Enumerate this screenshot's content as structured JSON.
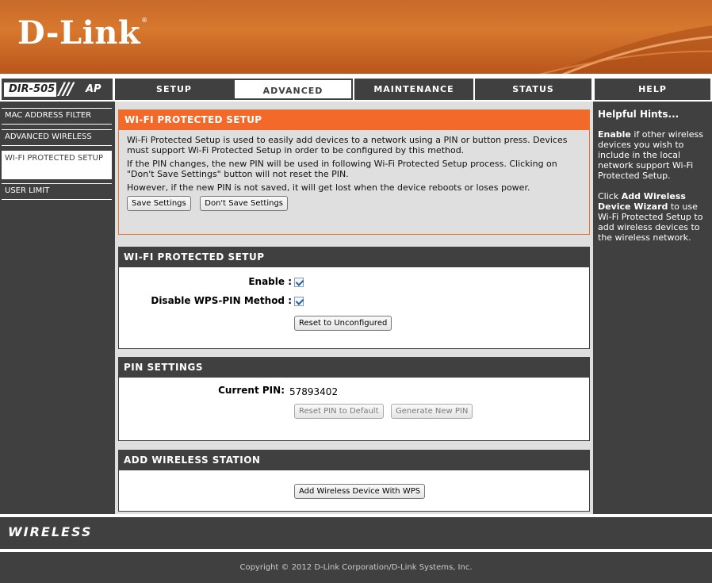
{
  "brand": {
    "logo": "D-Link",
    "registered": "®",
    "model": "DIR-505",
    "slash": "///",
    "mode": "AP"
  },
  "nav": {
    "tabs": [
      {
        "label": "SETUP",
        "active": false
      },
      {
        "label": "ADVANCED",
        "active": true
      },
      {
        "label": "MAINTENANCE",
        "active": false
      },
      {
        "label": "STATUS",
        "active": false
      },
      {
        "label": "HELP",
        "active": false
      }
    ]
  },
  "sidebar": {
    "items": [
      {
        "label": "MAC ADDRESS FILTER",
        "active": false
      },
      {
        "label": "ADVANCED WIRELESS",
        "active": false
      },
      {
        "label": "WI-FI PROTECTED SETUP",
        "active": true
      },
      {
        "label": "USER LIMIT",
        "active": false
      }
    ]
  },
  "intro": {
    "title": "WI-FI PROTECTED SETUP",
    "para1": "Wi-Fi Protected Setup is used to easily add devices to a network using a PIN or button press. Devices must support Wi-Fi Protected Setup in order to be configured by this method.",
    "para2": "If the PIN changes, the new PIN will be used in following Wi-Fi Protected Setup process. Clicking on \"Don't Save Settings\" button will not reset the PIN.",
    "para3": "However, if the new PIN is not saved, it will get lost when the device reboots or loses power.",
    "save_label": "Save Settings",
    "dont_save_label": "Don't Save Settings"
  },
  "wps": {
    "title": "WI-FI PROTECTED SETUP",
    "enable_label": "Enable :",
    "enable_checked": true,
    "disable_pin_label": "Disable WPS-PIN Method :",
    "disable_pin_checked": true,
    "reset_label": "Reset to Unconfigured"
  },
  "pin": {
    "title": "PIN SETTINGS",
    "current_label": "Current PIN:",
    "current_value": "57893402",
    "reset_default_label": "Reset PIN to Default",
    "generate_label": "Generate New PIN"
  },
  "station": {
    "title": "ADD WIRELESS STATION",
    "add_label": "Add Wireless Device With WPS"
  },
  "help": {
    "title": "Helpful Hints...",
    "hint1_bold": "Enable",
    "hint1_rest": " if other wireless devices you wish to include in the local network support Wi-Fi Protected Setup.",
    "hint2_pre": "Click ",
    "hint2_bold": "Add Wireless Device Wizard",
    "hint2_rest": " to use Wi-Fi Protected Setup to add wireless devices to the wireless network."
  },
  "footer": {
    "wireless": "WIRELESS",
    "copyright": "Copyright © 2012 D-Link Corporation/D-Link Systems, Inc."
  },
  "colors": {
    "orange": "#f2692a",
    "dark": "#404040",
    "panel": "#dfdfdf"
  }
}
